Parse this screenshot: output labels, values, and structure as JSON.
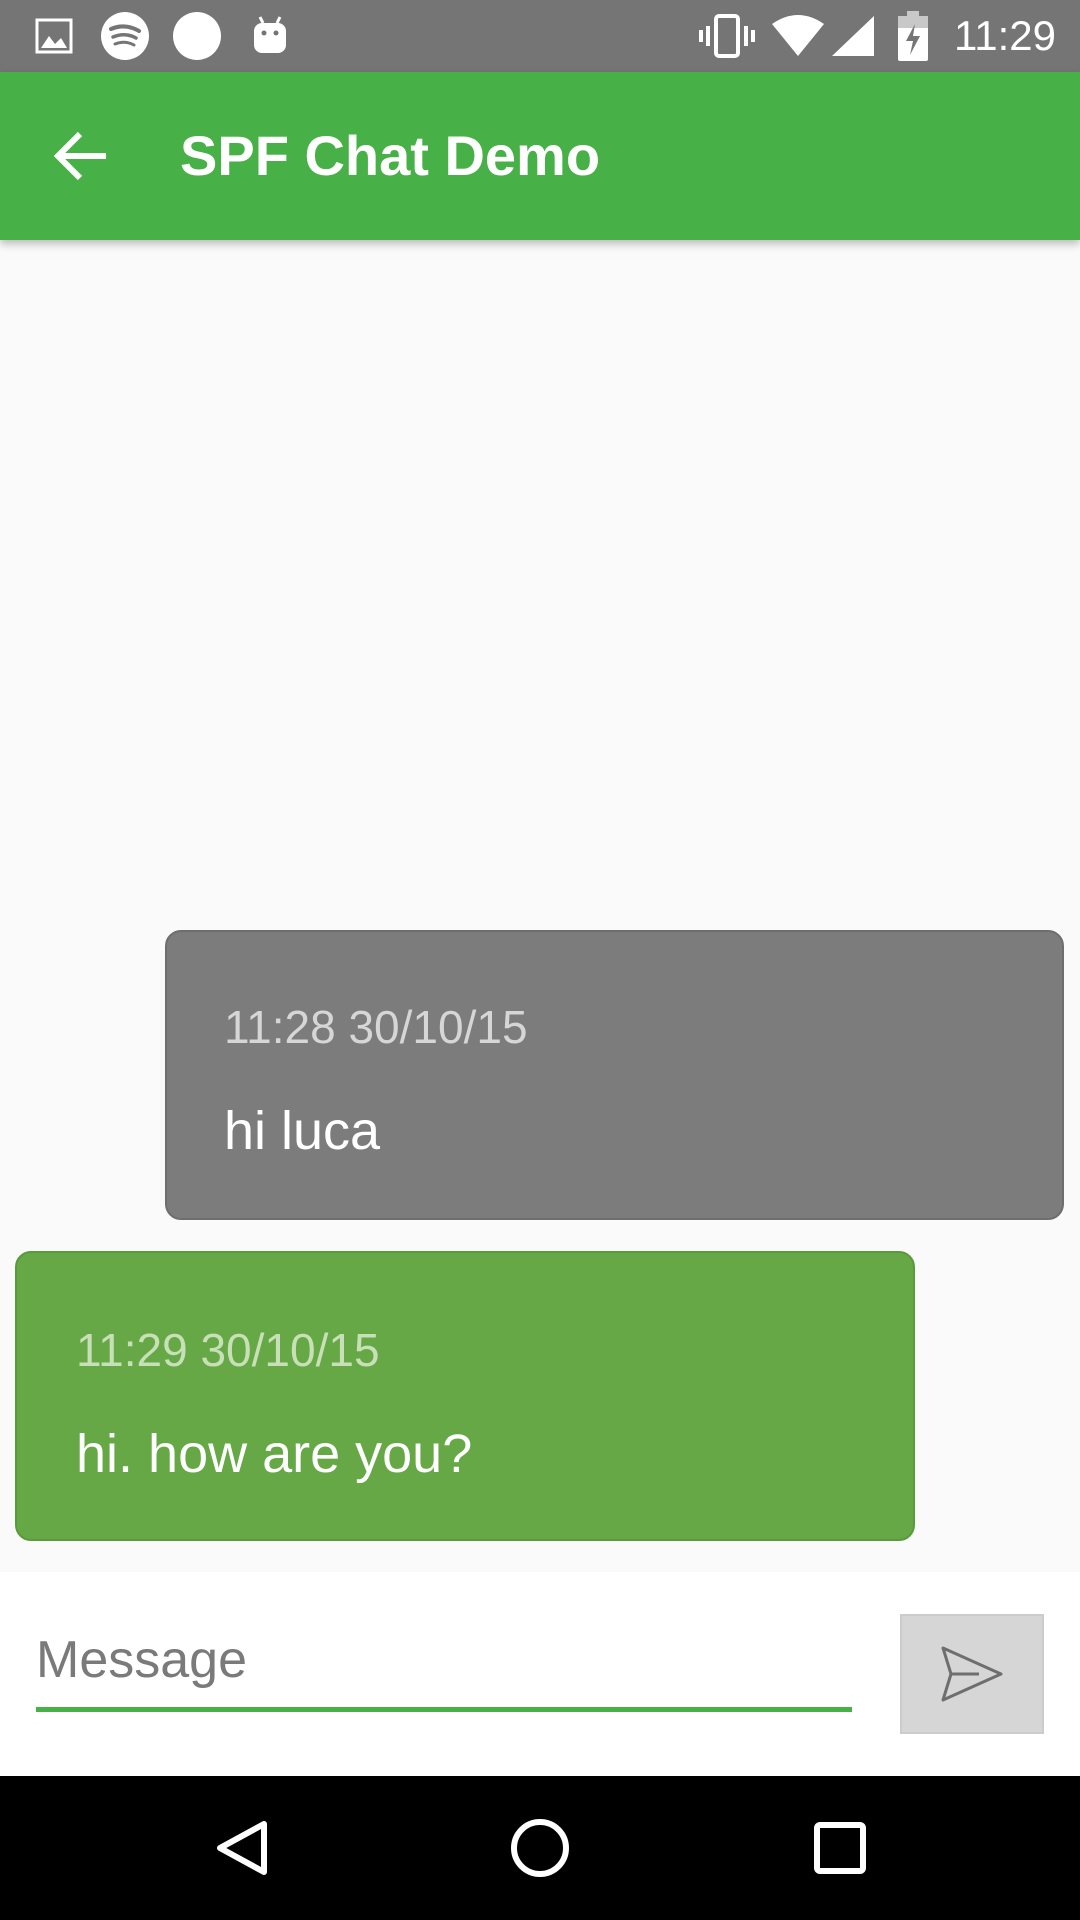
{
  "status_bar": {
    "time": "11:29",
    "left_icons": [
      "gallery-icon",
      "spotify-icon",
      "circle-icon",
      "android-icon"
    ],
    "right_icons": [
      "vibrate-icon",
      "wifi-icon",
      "signal-icon",
      "battery-charging-icon"
    ]
  },
  "app_bar": {
    "title": "SPF Chat Demo",
    "back_icon": "arrow-back-icon",
    "color": "#47b147"
  },
  "messages": [
    {
      "direction": "received",
      "timestamp": "11:28 30/10/15",
      "text": "hi luca",
      "color": "#7c7c7c"
    },
    {
      "direction": "sent",
      "timestamp": "11:29 30/10/15",
      "text": "hi. how are you?",
      "color": "#66a845"
    }
  ],
  "composer": {
    "placeholder": "Message",
    "value": "",
    "send_icon": "send-icon"
  },
  "nav_bar": {
    "icons": [
      "back-triangle-icon",
      "home-circle-icon",
      "recents-square-icon"
    ]
  }
}
